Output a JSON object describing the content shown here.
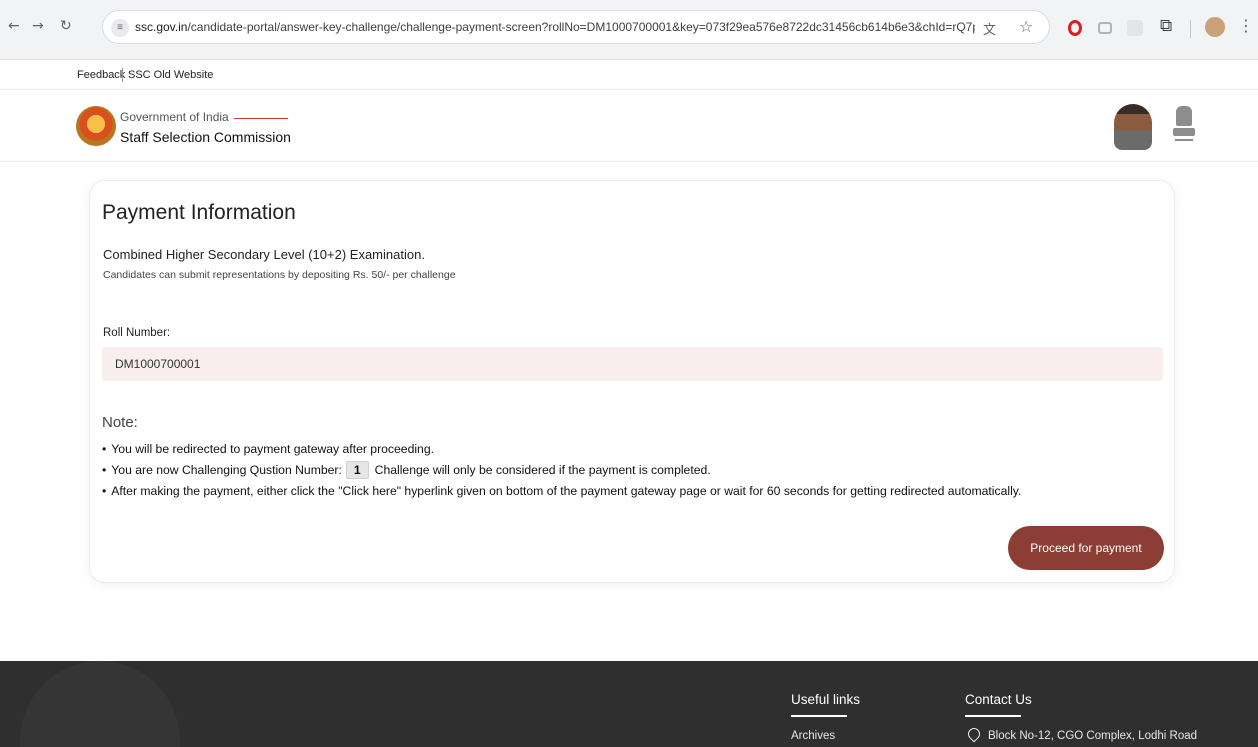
{
  "browser": {
    "url_domain": "ssc.gov.in",
    "url_path": "/candidate-portal/answer-key-challenge/challenge-payment-screen?rollNo=DM1000700001&key=073f29ea576e8722dc31456cb614b6e3&chId=rQ7py0%20%..."
  },
  "utility_links": [
    "Feedback",
    "SSC Old Website"
  ],
  "header": {
    "government": "Government of India",
    "organization": "Staff Selection Commission"
  },
  "payment": {
    "title": "Payment Information",
    "exam": "Combined Higher Secondary Level (10+2) Examination.",
    "subtitle": "Candidates can submit representations by depositing Rs. 50/- per challenge",
    "roll_label": "Roll Number:",
    "roll_value": "DM1000700001",
    "note_title": "Note:",
    "note_1": "You will be redirected to payment gateway after proceeding.",
    "note_2_prefix": "You are now Challenging Qustion Number:",
    "question_number": "1",
    "note_2_suffix": "Challenge will only be considered if the payment is completed.",
    "note_3": "After making the payment, either click the \"Click here\" hyperlink given on bottom of the payment gateway page or wait for 60 seconds for getting redirected automatically.",
    "proceed_label": "Proceed for payment"
  },
  "footer": {
    "useful_links_heading": "Useful links",
    "useful_link_1": "Archives",
    "contact_heading": "Contact Us",
    "address_line_1": "Block No-12, CGO Complex, Lodhi Road"
  }
}
